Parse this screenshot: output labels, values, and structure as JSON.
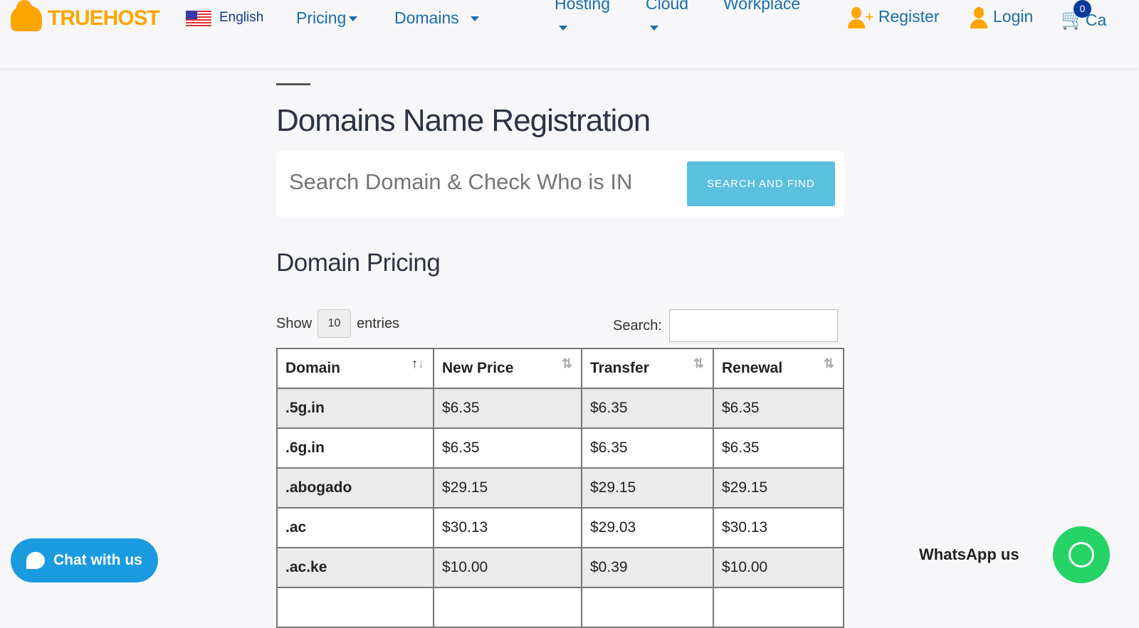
{
  "nav": {
    "logo": "TRUEHOST",
    "language": "English",
    "items": [
      "Pricing",
      "Domains",
      "Hosting",
      "Cloud",
      "Workplace"
    ],
    "register": "Register",
    "login": "Login",
    "cart": "Ca",
    "cart_count": "0"
  },
  "page": {
    "title": "Domains Name Registration",
    "search_placeholder": "Search Domain & Check Who is IN",
    "search_button": "SEARCH AND FIND",
    "section": "Domain Pricing"
  },
  "table_controls": {
    "show": "Show",
    "entries_value": "10",
    "entries": "entries",
    "search_label": "Search:"
  },
  "table": {
    "headers": [
      "Domain",
      "New Price",
      "Transfer",
      "Renewal"
    ],
    "rows": [
      [
        ".5g.in",
        "$6.35",
        "$6.35",
        "$6.35"
      ],
      [
        ".6g.in",
        "$6.35",
        "$6.35",
        "$6.35"
      ],
      [
        ".abogado",
        "$29.15",
        "$29.15",
        "$29.15"
      ],
      [
        ".ac",
        "$30.13",
        "$29.03",
        "$30.13"
      ],
      [
        ".ac.ke",
        "$10.00",
        "$0.39",
        "$10.00"
      ],
      [
        "",
        "",
        "",
        ""
      ]
    ]
  },
  "widgets": {
    "chat": "Chat with us",
    "whatsapp": "WhatsApp us"
  },
  "colors": {
    "brand": "#ffa500",
    "link": "#1a6ea8",
    "button": "#5bc0de",
    "whatsapp": "#25d366",
    "chat": "#1a9be0"
  }
}
